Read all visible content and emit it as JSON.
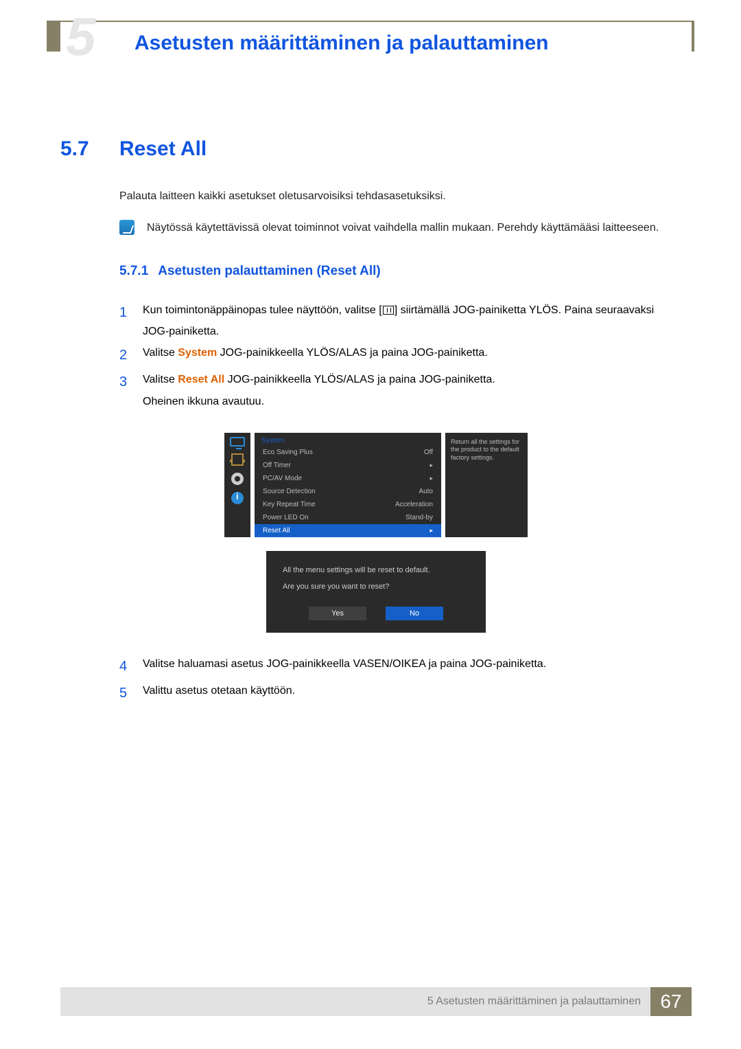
{
  "chapter": {
    "number": "5",
    "title": "Asetusten määrittäminen ja palauttaminen"
  },
  "section": {
    "number": "5.7",
    "title": "Reset All",
    "intro": "Palauta laitteen kaikki asetukset oletusarvoisiksi tehdasasetuksiksi.",
    "note": "Näytössä käytettävissä olevat toiminnot voivat vaihdella mallin mukaan. Perehdy käyttämääsi laitteeseen."
  },
  "subsection": {
    "number": "5.7.1",
    "title": "Asetusten palauttaminen (Reset All)"
  },
  "steps": {
    "1a": "Kun toimintonäppäinopas tulee näyttöön, valitse [",
    "1b": "] siirtämällä JOG-painiketta YLÖS. Paina seuraavaksi JOG-painiketta.",
    "2a": "Valitse ",
    "2_system": "System",
    "2b": " JOG-painikkeella YLÖS/ALAS ja paina JOG-painiketta.",
    "3a": "Valitse ",
    "3_reset": "Reset All",
    "3b": " JOG-painikkeella YLÖS/ALAS ja paina JOG-painiketta.",
    "3c": "Oheinen ikkuna avautuu.",
    "4": "Valitse haluamasi asetus JOG-painikkeella VASEN/OIKEA ja paina JOG-painiketta.",
    "5": "Valittu asetus otetaan käyttöön."
  },
  "osd": {
    "title": "System",
    "rows": [
      {
        "label": "Eco Saving Plus",
        "value": "Off"
      },
      {
        "label": "Off Timer",
        "value": "▸"
      },
      {
        "label": "PC/AV Mode",
        "value": "▸"
      },
      {
        "label": "Source Detection",
        "value": "Auto"
      },
      {
        "label": "Key Repeat Time",
        "value": "Acceleration"
      },
      {
        "label": "Power LED On",
        "value": "Stand-by"
      }
    ],
    "selected": {
      "label": "Reset All",
      "value": "▸"
    },
    "info": "Return all the settings for the product to the default factory settings."
  },
  "confirm": {
    "line1": "All the menu settings will be reset to default.",
    "line2": "Are you sure you want to reset?",
    "yes": "Yes",
    "no": "No"
  },
  "footer": {
    "text": "5 Asetusten määrittäminen ja palauttaminen",
    "page": "67"
  }
}
